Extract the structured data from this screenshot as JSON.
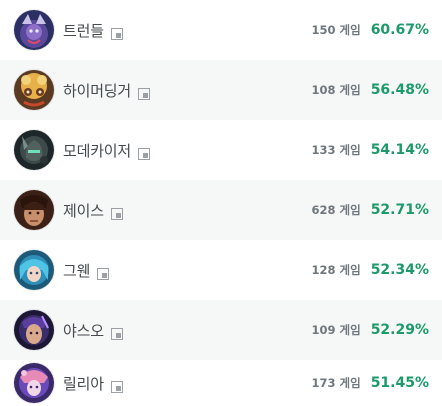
{
  "champions": [
    {
      "name": "트런들",
      "games": "150 게임",
      "winrate": "60.67%",
      "avatar_icon": "trundle-portrait"
    },
    {
      "name": "하이머딩거",
      "games": "108 게임",
      "winrate": "56.48%",
      "avatar_icon": "heimerdinger-portrait"
    },
    {
      "name": "모데카이저",
      "games": "133 게임",
      "winrate": "54.14%",
      "avatar_icon": "mordekaiser-portrait"
    },
    {
      "name": "제이스",
      "games": "628 게임",
      "winrate": "52.71%",
      "avatar_icon": "jayce-portrait"
    },
    {
      "name": "그웬",
      "games": "128 게임",
      "winrate": "52.34%",
      "avatar_icon": "gwen-portrait"
    },
    {
      "name": "야스오",
      "games": "109 게임",
      "winrate": "52.29%",
      "avatar_icon": "yasuo-portrait"
    },
    {
      "name": "릴리아",
      "games": "173 게임",
      "winrate": "51.45%",
      "avatar_icon": "lillia-portrait"
    }
  ],
  "colors": {
    "winrate": "#1c9a69",
    "games": "#6f777c",
    "name": "#444a4e",
    "alt_row": "#f6f7f7"
  },
  "build_icon": "build-link-icon"
}
